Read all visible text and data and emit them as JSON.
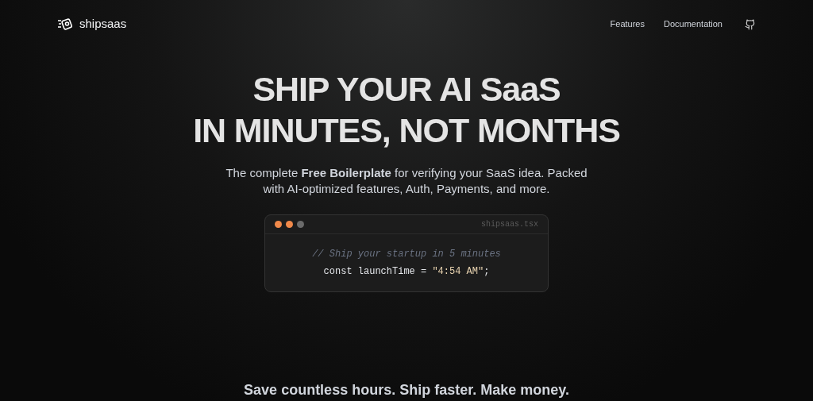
{
  "nav": {
    "brand": "shipsaas",
    "links": [
      "Features",
      "Documentation"
    ]
  },
  "hero": {
    "title_lines": [
      "SHIP YOUR AI SaaS",
      "IN MINUTES, NOT MONTHS"
    ],
    "subtitle": "The complete **Free Boilerplate** for verifying your SaaS idea. Packed with AI-optimized features, Auth, Payments, and more."
  },
  "code_window": {
    "filename": "shipsaas.tsx",
    "dots": [
      {
        "color": "#f0894a"
      },
      {
        "color": "#f0894a"
      },
      {
        "color": "#6b6b6b"
      }
    ],
    "comment": "// Ship your startup in 5 minutes",
    "code": [
      {
        "kind": "plain",
        "text": "const launchTime = "
      },
      {
        "kind": "string",
        "text": "\"4:54 AM\""
      },
      {
        "kind": "plain",
        "text": ";"
      }
    ]
  },
  "section": {
    "heading": "Save countless hours. Ship faster. Make money."
  }
}
